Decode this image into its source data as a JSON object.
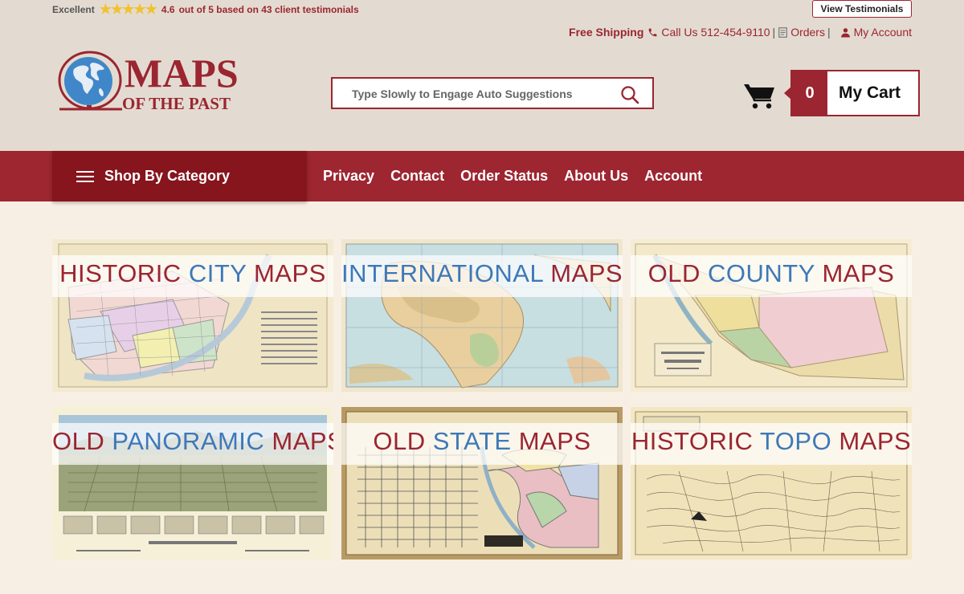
{
  "rating": {
    "label": "Excellent",
    "stars": "★★★★★",
    "score": "4.6",
    "text": "out of 5 based on 43 client testimonials"
  },
  "header": {
    "view_testimonials": "View Testimonials",
    "free_shipping": "Free Shipping",
    "call": "Call Us 512-454-9110",
    "orders": "Orders",
    "account": "My Account",
    "separator": "|"
  },
  "logo": {
    "line1": "MAPS",
    "line2": "OF THE PAST"
  },
  "search": {
    "placeholder": "Type Slowly to Engage Auto Suggestions"
  },
  "cart": {
    "count": "0",
    "label": "My Cart"
  },
  "nav": {
    "shop_by_category": "Shop By Category",
    "links": [
      "Privacy",
      "Contact",
      "Order Status",
      "About Us",
      "Account"
    ]
  },
  "tiles": [
    {
      "w1": "HISTORIC ",
      "w2": "CITY",
      "w3": " MAPS"
    },
    {
      "w1": "INTERNATIONAL",
      "w2": "",
      "w3": " MAPS"
    },
    {
      "w1": "OLD ",
      "w2": "COUNTY",
      "w3": " MAPS"
    },
    {
      "w1": "OLD ",
      "w2": "PANORAMIC",
      "w3": " MAPS"
    },
    {
      "w1": "OLD ",
      "w2": "STATE",
      "w3": " MAPS"
    },
    {
      "w1": "HISTORIC ",
      "w2": "TOPO",
      "w3": " MAPS"
    }
  ],
  "colors": {
    "brand": "#9d2630",
    "brand_dark": "#86151d",
    "accent_blue": "#3e78b8",
    "star": "#f2c12e"
  }
}
